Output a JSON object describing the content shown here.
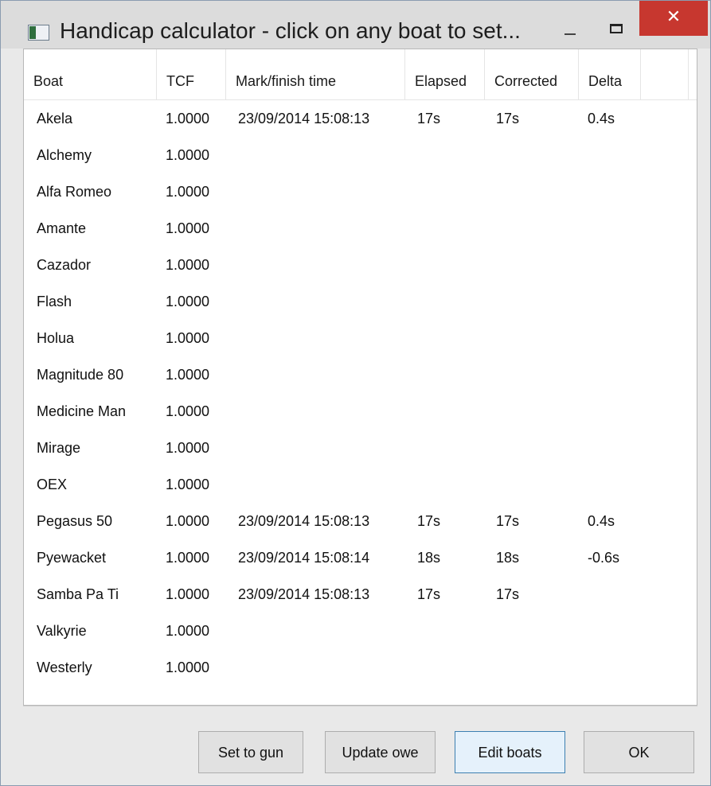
{
  "window": {
    "title": "Handicap calculator - click on any boat to set...",
    "controls": {
      "minimize": "−",
      "close": "✕"
    }
  },
  "table": {
    "columns": [
      "Boat",
      "TCF",
      "Mark/finish time",
      "Elapsed",
      "Corrected",
      "Delta",
      ""
    ],
    "rows": [
      {
        "boat": "Akela",
        "tcf": "1.0000",
        "time": "23/09/2014 15:08:13",
        "elapsed": "17s",
        "corrected": "17s",
        "delta": "0.4s"
      },
      {
        "boat": "Alchemy",
        "tcf": "1.0000",
        "time": "",
        "elapsed": "",
        "corrected": "",
        "delta": ""
      },
      {
        "boat": "Alfa Romeo",
        "tcf": "1.0000",
        "time": "",
        "elapsed": "",
        "corrected": "",
        "delta": ""
      },
      {
        "boat": "Amante",
        "tcf": "1.0000",
        "time": "",
        "elapsed": "",
        "corrected": "",
        "delta": ""
      },
      {
        "boat": "Cazador",
        "tcf": "1.0000",
        "time": "",
        "elapsed": "",
        "corrected": "",
        "delta": ""
      },
      {
        "boat": "Flash",
        "tcf": "1.0000",
        "time": "",
        "elapsed": "",
        "corrected": "",
        "delta": ""
      },
      {
        "boat": "Holua",
        "tcf": "1.0000",
        "time": "",
        "elapsed": "",
        "corrected": "",
        "delta": ""
      },
      {
        "boat": "Magnitude 80",
        "tcf": "1.0000",
        "time": "",
        "elapsed": "",
        "corrected": "",
        "delta": ""
      },
      {
        "boat": "Medicine Man",
        "tcf": "1.0000",
        "time": "",
        "elapsed": "",
        "corrected": "",
        "delta": ""
      },
      {
        "boat": "Mirage",
        "tcf": "1.0000",
        "time": "",
        "elapsed": "",
        "corrected": "",
        "delta": ""
      },
      {
        "boat": "OEX",
        "tcf": "1.0000",
        "time": "",
        "elapsed": "",
        "corrected": "",
        "delta": ""
      },
      {
        "boat": "Pegasus 50",
        "tcf": "1.0000",
        "time": "23/09/2014 15:08:13",
        "elapsed": "17s",
        "corrected": "17s",
        "delta": "0.4s"
      },
      {
        "boat": "Pyewacket",
        "tcf": "1.0000",
        "time": "23/09/2014 15:08:14",
        "elapsed": "18s",
        "corrected": "18s",
        "delta": "-0.6s"
      },
      {
        "boat": "Samba Pa Ti",
        "tcf": "1.0000",
        "time": "23/09/2014 15:08:13",
        "elapsed": "17s",
        "corrected": "17s",
        "delta": ""
      },
      {
        "boat": "Valkyrie",
        "tcf": "1.0000",
        "time": "",
        "elapsed": "",
        "corrected": "",
        "delta": ""
      },
      {
        "boat": "Westerly",
        "tcf": "1.0000",
        "time": "",
        "elapsed": "",
        "corrected": "",
        "delta": ""
      }
    ]
  },
  "buttons": {
    "set_to_gun": "Set to gun",
    "update_owe": "Update owe",
    "edit_boats": "Edit boats",
    "ok": "OK"
  },
  "icons": {
    "app": "window-app-icon",
    "minimize": "minimize-icon",
    "maximize": "maximize-icon",
    "close": "close-icon"
  },
  "colors": {
    "close_button": "#c7372f",
    "default_button_border": "#3c7fb1"
  }
}
